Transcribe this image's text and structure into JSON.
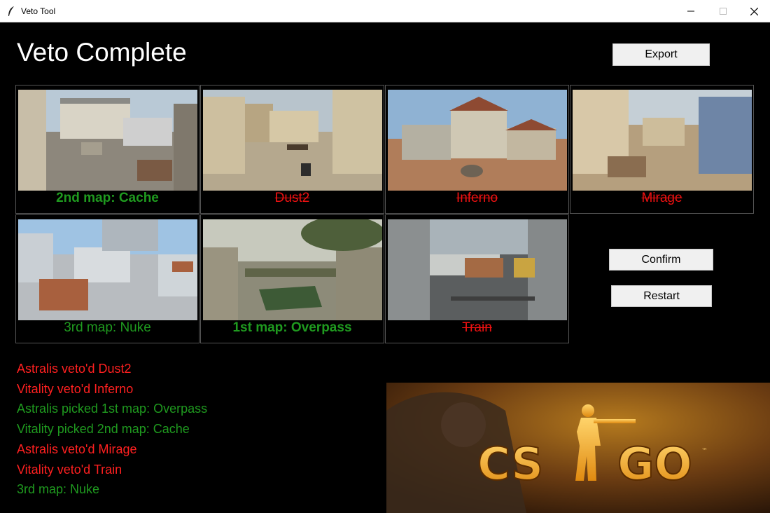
{
  "window": {
    "title": "Veto Tool"
  },
  "heading": "Veto Complete",
  "buttons": {
    "export": "Export",
    "confirm": "Confirm",
    "restart": "Restart"
  },
  "maps": [
    {
      "name": "Cache",
      "label": "2nd map: Cache",
      "status": "pick"
    },
    {
      "name": "Dust2",
      "label": "Dust2",
      "status": "ban"
    },
    {
      "name": "Inferno",
      "label": "Inferno",
      "status": "ban"
    },
    {
      "name": "Mirage",
      "label": "Mirage",
      "status": "ban"
    },
    {
      "name": "Nuke",
      "label": "3rd map: Nuke",
      "status": "decider"
    },
    {
      "name": "Overpass",
      "label": "1st map: Overpass",
      "status": "pick"
    },
    {
      "name": "Train",
      "label": "Train",
      "status": "ban"
    }
  ],
  "log": [
    {
      "text": "Astralis veto'd Dust2",
      "type": "ban"
    },
    {
      "text": "Vitality veto'd Inferno",
      "type": "ban"
    },
    {
      "text": "Astralis picked 1st map: Overpass",
      "type": "pick"
    },
    {
      "text": "Vitality picked 2nd map: Cache",
      "type": "pick"
    },
    {
      "text": "Astralis veto'd Mirage",
      "type": "ban"
    },
    {
      "text": "Vitality veto'd Train",
      "type": "ban"
    },
    {
      "text": "3rd map: Nuke",
      "type": "pick"
    }
  ],
  "banner": {
    "logo_text": "CS GO",
    "trademark": "™"
  },
  "colors": {
    "pick": "#1f9a1f",
    "ban": "#ee1111",
    "background": "#000000"
  }
}
